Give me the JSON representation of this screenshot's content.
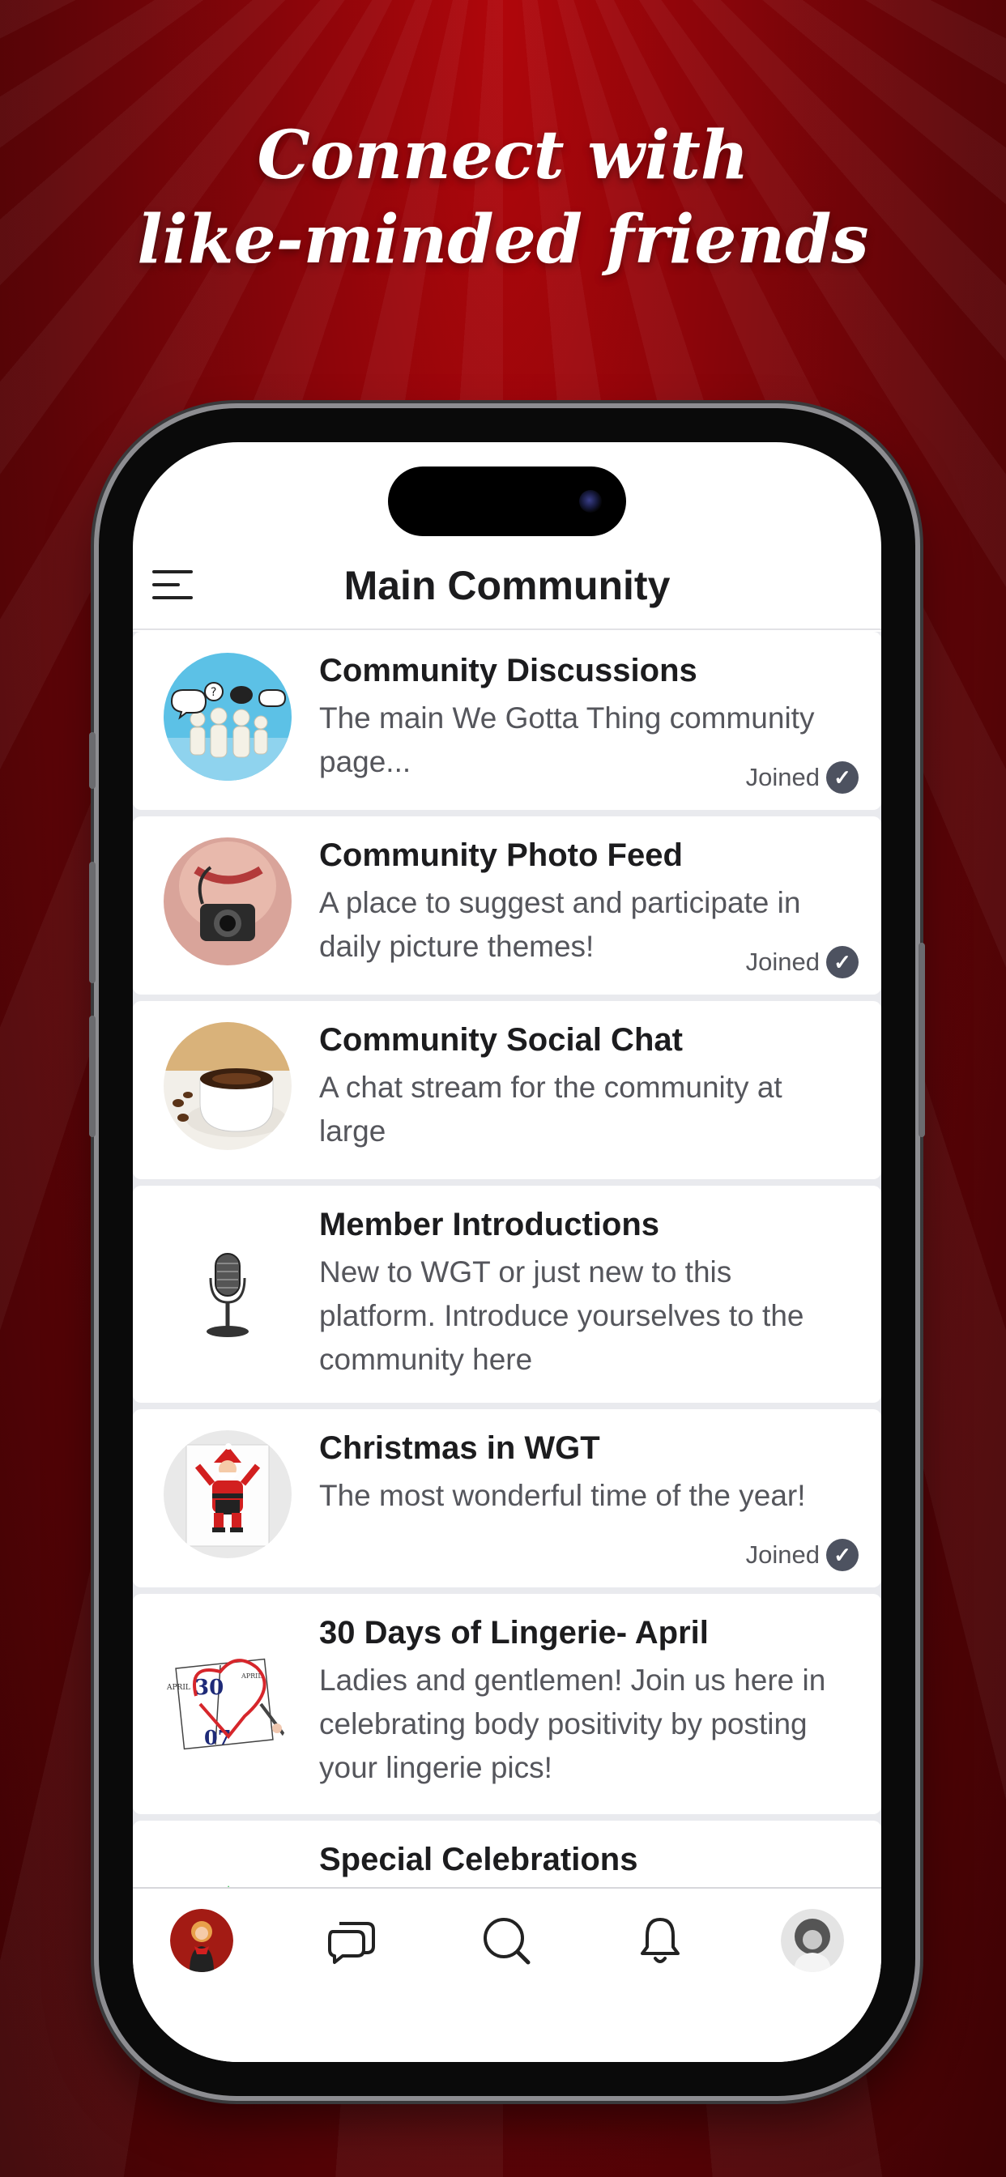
{
  "headline": {
    "line1": "Connect with",
    "line2": "like-minded friends"
  },
  "app": {
    "title": "Main Community"
  },
  "communities": [
    {
      "title": "Community Discussions",
      "description": "The main We Gotta Thing community page...",
      "status": "Joined",
      "thumb": "people-speech-bubbles-image"
    },
    {
      "title": "Community Photo Feed",
      "description": "A place to suggest and participate in daily picture themes!",
      "status": "Joined",
      "thumb": "camera-photo-image"
    },
    {
      "title": "Community Social Chat",
      "description": "A chat stream for the community at large",
      "status": "",
      "thumb": "coffee-cup-image"
    },
    {
      "title": "Member Introductions",
      "description": "New to WGT or just new to this platform. Introduce yourselves to the community here",
      "status": "",
      "thumb": "microphone-image"
    },
    {
      "title": "Christmas in WGT",
      "description": "The most wonderful time of the year!",
      "status": "Joined",
      "thumb": "santa-image"
    },
    {
      "title": "30 Days of Lingerie- April",
      "description": "Ladies and gentlemen! Join us here in celebrating body positivity by posting your lingerie pics!",
      "status": "",
      "thumb": "calendar-heart-image",
      "calendar_text": {
        "month1": "APRIL",
        "day1": "30",
        "month2": "APRIL",
        "day2": "07"
      }
    },
    {
      "title": "Special Celebrations",
      "description": "",
      "status": "",
      "thumb": "celebration-image"
    }
  ],
  "tabbar": {
    "items": [
      "home-avatar",
      "chat-icon",
      "search-icon",
      "bell-icon",
      "profile-avatar"
    ]
  },
  "colors": {
    "accent": "#a00509",
    "check": "#4d5260"
  }
}
